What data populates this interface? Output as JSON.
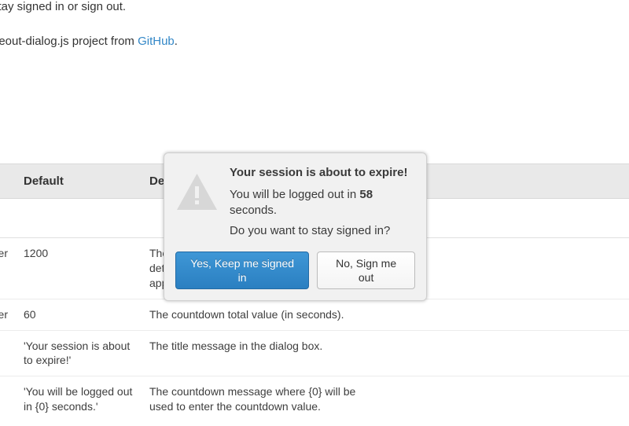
{
  "intro": {
    "line1_fragment": "stay signed in or sign out.",
    "line2_prefix": "neout-dialog.js project from ",
    "link_text": "GitHub",
    "line2_suffix": "."
  },
  "table": {
    "headers": {
      "default": "Default",
      "description_fragment": "De"
    },
    "rows": [
      {
        "col_a_suffix": "er",
        "default": "1200",
        "description": "The … (in … minus the countdown value determines how long until the dialog appears."
      },
      {
        "col_a_suffix": "er",
        "default": "60",
        "description": "The countdown total value (in seconds)."
      },
      {
        "col_a_suffix": "",
        "default": "'Your session is about to expire!'",
        "description": "The title message in the dialog box."
      },
      {
        "col_a_suffix": "",
        "default": "'You will be logged out in {0} seconds.'",
        "description": "The countdown message where {0} will be used to enter the countdown value."
      }
    ]
  },
  "dialog": {
    "title": "Your session is about to expire!",
    "msg_prefix": "You will be logged out in ",
    "countdown": "58",
    "msg_suffix": " seconds.",
    "question": "Do you want to stay signed in?",
    "keep_label": "Yes, Keep me signed in",
    "signout_label": "No, Sign me out"
  }
}
